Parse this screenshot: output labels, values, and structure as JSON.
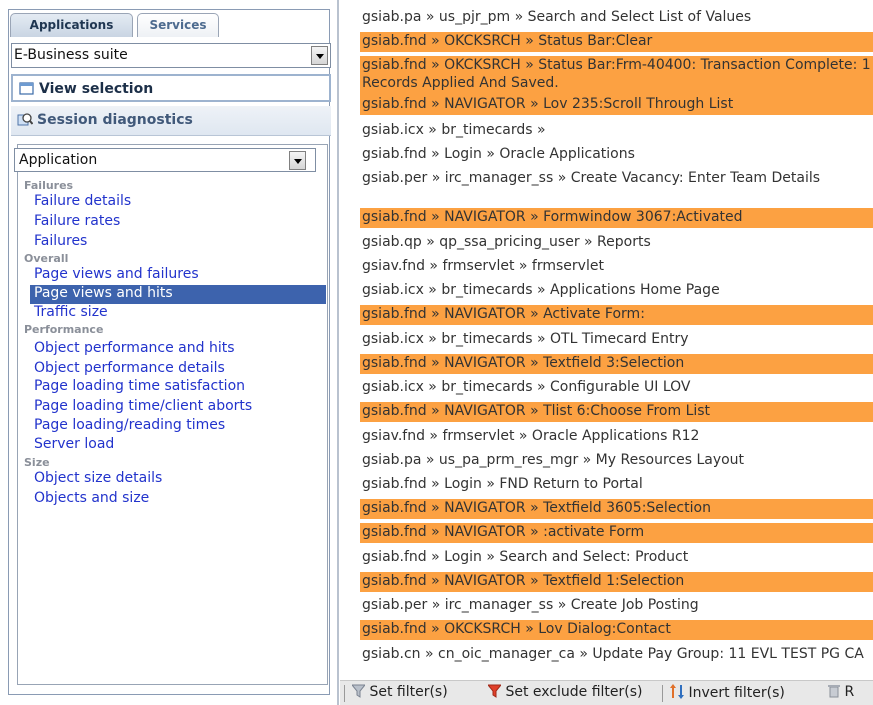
{
  "tabs": {
    "active": "Applications",
    "inactive": "Services"
  },
  "suite_select": {
    "value": "E-Business suite"
  },
  "view_selection": "View selection",
  "session_diagnostics": "Session diagnostics",
  "app_select": {
    "value": "Application"
  },
  "nav": {
    "failures_header": "Failures",
    "failure_details": "Failure details",
    "failure_rates": "Failure rates",
    "failures": "Failures",
    "overall_header": "Overall",
    "page_views_failures": "Page views and failures",
    "page_views_hits": "Page views and hits",
    "traffic_size": "Traffic size",
    "performance_header": "Performance",
    "obj_perf_hits": "Object performance and hits",
    "obj_perf_details": "Object performance details",
    "page_load_satisfaction": "Page loading time satisfaction",
    "page_load_aborts": "Page loading time/client aborts",
    "page_load_reading": "Page loading/reading times",
    "server_load": "Server load",
    "size_header": "Size",
    "obj_size_details": "Object size details",
    "objects_size": "Objects and size"
  },
  "rows": [
    {
      "text": "gsiab.pa » us_pjr_pm » Search and Select List of Values",
      "hl": false
    },
    {
      "text": "gsiab.fnd » OKCKSRCH » Status Bar:Clear",
      "hl": true
    },
    {
      "text": "gsiab.fnd » OKCKSRCH » Status Bar:Frm-40400: Transaction Complete: 1 Records Applied And Saved.",
      "hl": true
    },
    {
      "text": "gsiab.fnd » NAVIGATOR » Lov 235:Scroll Through List",
      "hl": true
    },
    {
      "text": "gsiab.icx » br_timecards »",
      "hl": false
    },
    {
      "text": "gsiab.fnd » Login » Oracle Applications",
      "hl": false
    },
    {
      "text": "gsiab.per » irc_manager_ss » Create Vacancy: Enter Team Details",
      "hl": false
    },
    {
      "text": "gsiab.fnd » NAVIGATOR » Formwindow 3067:Activated",
      "hl": true
    },
    {
      "text": "gsiab.qp » qp_ssa_pricing_user » Reports",
      "hl": false
    },
    {
      "text": "gsiav.fnd » frmservlet » frmservlet",
      "hl": false
    },
    {
      "text": "gsiab.icx » br_timecards » Applications Home Page",
      "hl": false
    },
    {
      "text": "gsiab.fnd » NAVIGATOR » Activate Form:",
      "hl": true
    },
    {
      "text": "gsiab.icx » br_timecards » OTL Timecard Entry",
      "hl": false
    },
    {
      "text": "gsiab.fnd » NAVIGATOR » Textfield 3:Selection",
      "hl": true
    },
    {
      "text": "gsiab.icx » br_timecards » Configurable UI LOV",
      "hl": false
    },
    {
      "text": "gsiab.fnd » NAVIGATOR » Tlist 6:Choose From List",
      "hl": true
    },
    {
      "text": "gsiav.fnd » frmservlet » Oracle Applications R12",
      "hl": false
    },
    {
      "text": "gsiab.pa » us_pa_prm_res_mgr » My Resources Layout",
      "hl": false
    },
    {
      "text": "gsiab.fnd » Login » FND Return to Portal",
      "hl": false
    },
    {
      "text": "gsiab.fnd » NAVIGATOR » Textfield 3605:Selection",
      "hl": true
    },
    {
      "text": "gsiab.fnd » NAVIGATOR » :activate Form",
      "hl": true
    },
    {
      "text": "gsiab.fnd » Login » Search and Select: Product",
      "hl": false
    },
    {
      "text": "gsiab.fnd » NAVIGATOR » Textfield 1:Selection",
      "hl": true
    },
    {
      "text": "gsiab.per » irc_manager_ss » Create Job Posting",
      "hl": false
    },
    {
      "text": "gsiab.fnd » OKCKSRCH » Lov Dialog:Contact",
      "hl": true
    },
    {
      "text": "gsiab.cn » cn_oic_manager_ca » Update Pay Group: 11 EVL TEST PG CA",
      "hl": false
    }
  ],
  "statusbar": {
    "set_filter": "Set filter(s)",
    "set_exclude": "Set exclude filter(s)",
    "invert": "Invert filter(s)",
    "reset": "R"
  }
}
